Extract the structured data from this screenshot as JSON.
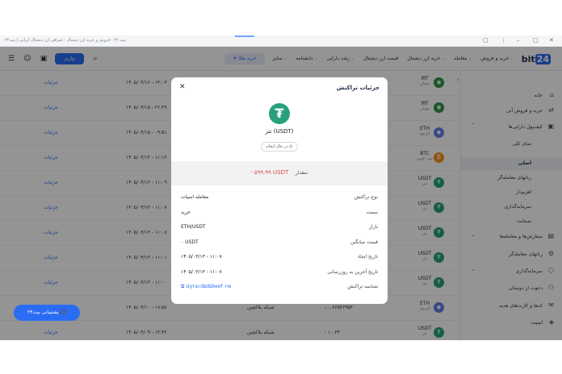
{
  "browser": {
    "title": "بیت ۲۴ - فروش و خرید ارز دیجیتال - صرافی ارز دیجیتال ایرانی | بیت۲۴",
    "tab_accent": "#6ea8ff"
  },
  "nav": {
    "logo_text": "bit",
    "logo_num": "24",
    "links": [
      "خرید و فروش",
      "معامله",
      "خرید ارز دیجیتال",
      "قیمت ارز دیجیتال",
      "رشد دارایی",
      "دانشنامه",
      "سایر"
    ],
    "gold_btn": "خرید طلا",
    "deposit_btn": "واریز"
  },
  "sidebar": {
    "items": [
      {
        "label": "خانه",
        "icon": "home-icon"
      },
      {
        "label": "خرید و فروش آنی",
        "icon": "swap-icon"
      },
      {
        "label": "کیف‌پول دارایی‌ها",
        "icon": "wallet-icon"
      },
      {
        "label": "نمای کلی",
        "icon": ""
      },
      {
        "label": "اصلی",
        "icon": ""
      },
      {
        "label": "رباتهای معامله‌گر",
        "icon": ""
      },
      {
        "label": "اهرم‌دار",
        "icon": ""
      },
      {
        "label": "سرمایه‌گذاری",
        "icon": ""
      },
      {
        "label": "ضمانت",
        "icon": ""
      },
      {
        "label": "سفارش‌ها و معامله‌ها",
        "icon": "orders-icon"
      },
      {
        "label": "رباتهای معامله‌گر",
        "icon": "robot-icon"
      },
      {
        "label": "سرمایه‌گذاری",
        "icon": "invest-icon"
      },
      {
        "label": "دعوت از دوستان",
        "icon": "users-icon"
      },
      {
        "label": "کدها و کارت‌های هدیه",
        "icon": "gift-icon"
      },
      {
        "label": "امنیت",
        "icon": "shield-icon"
      }
    ]
  },
  "table": {
    "rows": [
      {
        "sym": "IRT",
        "name": "تومان",
        "date": "۱۴۰۵/۰۳/۱۶ - ۱۴:۰۳",
        "net": "",
        "amt": "",
        "details": "جزئیات",
        "color": "#2b9348"
      },
      {
        "sym": "IRT",
        "name": "تومان",
        "date": "۱۴۰۵/۰۳/۱۵ - ۲۲:۲۹",
        "net": "",
        "amt": "",
        "details": "جزئیات",
        "color": "#2b9348"
      },
      {
        "sym": "ETH",
        "name": "اتریوم",
        "date": "۱۴۰۵/۰۳/۱۵ - ۰۹:۵۱",
        "net": "",
        "amt": "",
        "details": "جزئیات",
        "color": "#627eea"
      },
      {
        "sym": "BTC",
        "name": "بیت کوین",
        "date": "۱۴۰۵/۰۳/۱۴ - ۱۱:۱۲",
        "net": "",
        "amt": "",
        "details": "جزئیات",
        "color": "#f7931a"
      },
      {
        "sym": "USDT",
        "name": "تتر",
        "date": "۱۴۰۵/۰۳/۱۳ - ۱۱:۰۹",
        "net": "",
        "amt": "",
        "details": "جزئیات",
        "color": "#26a17b"
      },
      {
        "sym": "USDT",
        "name": "تتر",
        "date": "۱۴۰۵/۰۳/۱۳ - ۱۱:۰۷",
        "net": "",
        "amt": "",
        "details": "جزئیات",
        "color": "#26a17b"
      },
      {
        "sym": "USDT",
        "name": "تتر",
        "date": "۱۴۰۵/۰۳/۱۳ - ۱۱:۰۷",
        "net": "",
        "amt": "",
        "details": "جزئیات",
        "color": "#26a17b"
      },
      {
        "sym": "USDT",
        "name": "تتر",
        "date": "۱۴۰۵/۰۳/۱۳ - ۱۱:۰۱",
        "net": "",
        "amt": "",
        "details": "جزئیات",
        "color": "#26a17b"
      },
      {
        "sym": "USDT",
        "name": "تتر",
        "date": "۱۴۰۵/۰۳/۱۳ - ۱۱:۰۰",
        "net": "",
        "amt": "",
        "details": "جزئیات",
        "color": "#26a17b"
      },
      {
        "sym": "ETH",
        "name": "اتریوم",
        "date": "۱۴۰۵/۰۳/۱۰ - ۱۸:۵۸",
        "net": "شبکه بلاکچین",
        "amt": "- ۰.۶۶۵۴۶۹۵۴",
        "details": "جزئیات",
        "color": "#627eea"
      },
      {
        "sym": "USDT",
        "name": "تتر",
        "date": "۱۴۰۵/۰۳/۰۹ - ۱۴:۴۲",
        "net": "شبکه بلاکچین",
        "amt": "- ۱۰.۳۳",
        "details": "جزئیات",
        "color": "#26a17b"
      }
    ]
  },
  "support_btn": "پشتیبانی بیت۲۴",
  "modal": {
    "title": "جزئیات تراکنش",
    "coin": "تتر (USDT)",
    "status": "در حال انجام",
    "amount_label": "مقدار:",
    "amount_value": "- ۵۹۹.۹۹ USDT",
    "details": [
      {
        "k": "نوع تراکنش",
        "v": "معامله اسپات"
      },
      {
        "k": "سمت",
        "v": "خرید"
      },
      {
        "k": "بازار",
        "v": "ETH/USDT"
      },
      {
        "k": "قیمت میانگین",
        "v": "۰ USDT"
      },
      {
        "k": "تاریخ ایجاد",
        "v": "۱۴۰۵/۰۳/۱۳ - ۱۱:۰۷"
      },
      {
        "k": "تاریخ آخرین به روزرسانی",
        "v": "۱۴۰۵/۰۳/۱۳ - ۱۱:۰۷"
      },
      {
        "k": "شناسه تراکنش",
        "v": "Uy۲a۱d۵d۵beef۰rw"
      }
    ]
  }
}
